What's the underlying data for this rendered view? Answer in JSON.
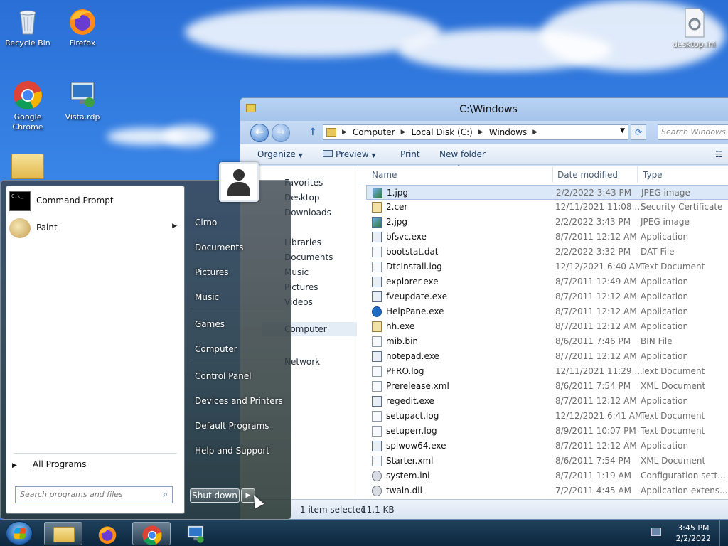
{
  "desktop": {
    "icons": [
      {
        "label": "Recycle Bin",
        "icon": "recycle-bin-icon"
      },
      {
        "label": "Firefox",
        "icon": "firefox-icon"
      },
      {
        "label": "Google Chrome",
        "icon": "chrome-icon"
      },
      {
        "label": "Vista.rdp",
        "icon": "rdp-icon"
      },
      {
        "label": "desktop.ini",
        "icon": "settings-file-icon"
      }
    ]
  },
  "explorer": {
    "title": "C:\\Windows",
    "breadcrumb": [
      "Computer",
      "Local Disk (C:)",
      "Windows"
    ],
    "search_placeholder": "Search Windows",
    "toolbar": {
      "organize": "Organize",
      "preview": "Preview",
      "print": "Print",
      "new_folder": "New folder"
    },
    "nav_items": [
      "Favorites",
      "Desktop",
      "Downloads",
      "Libraries",
      "Documents",
      "Music",
      "Pictures",
      "Videos",
      "Computer",
      "Network"
    ],
    "columns": {
      "name": "Name",
      "date": "Date modified",
      "type": "Type"
    },
    "files": [
      {
        "name": "1.jpg",
        "date": "2/2/2022 3:43 PM",
        "type": "JPEG image",
        "icon": "img",
        "selected": true
      },
      {
        "name": "2.cer",
        "date": "12/11/2021 11:08 ...",
        "type": "Security Certificate",
        "icon": "cer"
      },
      {
        "name": "2.jpg",
        "date": "2/2/2022 3:43 PM",
        "type": "JPEG image",
        "icon": "img"
      },
      {
        "name": "bfsvc.exe",
        "date": "8/7/2011 12:12 AM",
        "type": "Application",
        "icon": "exe"
      },
      {
        "name": "bootstat.dat",
        "date": "2/2/2022 3:32 PM",
        "type": "DAT File",
        "icon": "doc"
      },
      {
        "name": "DtcInstall.log",
        "date": "12/12/2021 6:40 AM",
        "type": "Text Document",
        "icon": "doc"
      },
      {
        "name": "explorer.exe",
        "date": "8/7/2011 12:49 AM",
        "type": "Application",
        "icon": "exe"
      },
      {
        "name": "fveupdate.exe",
        "date": "8/7/2011 12:12 AM",
        "type": "Application",
        "icon": "exe"
      },
      {
        "name": "HelpPane.exe",
        "date": "8/7/2011 12:12 AM",
        "type": "Application",
        "icon": "help"
      },
      {
        "name": "hh.exe",
        "date": "8/7/2011 12:12 AM",
        "type": "Application",
        "icon": "cer"
      },
      {
        "name": "mib.bin",
        "date": "8/6/2011 7:46 PM",
        "type": "BIN File",
        "icon": "doc"
      },
      {
        "name": "notepad.exe",
        "date": "8/7/2011 12:12 AM",
        "type": "Application",
        "icon": "exe"
      },
      {
        "name": "PFRO.log",
        "date": "12/11/2021 11:29 ...",
        "type": "Text Document",
        "icon": "doc"
      },
      {
        "name": "Prerelease.xml",
        "date": "8/6/2011 7:54 PM",
        "type": "XML Document",
        "icon": "doc"
      },
      {
        "name": "regedit.exe",
        "date": "8/7/2011 12:12 AM",
        "type": "Application",
        "icon": "exe"
      },
      {
        "name": "setupact.log",
        "date": "12/12/2021 6:41 AM",
        "type": "Text Document",
        "icon": "doc"
      },
      {
        "name": "setuperr.log",
        "date": "8/9/2011 10:07 PM",
        "type": "Text Document",
        "icon": "doc"
      },
      {
        "name": "splwow64.exe",
        "date": "8/7/2011 12:12 AM",
        "type": "Application",
        "icon": "exe"
      },
      {
        "name": "Starter.xml",
        "date": "8/6/2011 7:54 PM",
        "type": "XML Document",
        "icon": "doc"
      },
      {
        "name": "system.ini",
        "date": "8/7/2011 1:19 AM",
        "type": "Configuration sett...",
        "icon": "gear"
      },
      {
        "name": "twain.dll",
        "date": "7/2/2011 4:45 AM",
        "type": "Application extens...",
        "icon": "gear"
      }
    ],
    "status": {
      "selected": "1 item selected",
      "size": "11.1 KB"
    }
  },
  "start_menu": {
    "pinned": [
      {
        "label": "Command Prompt",
        "icon": "cmd-icon"
      },
      {
        "label": "Paint",
        "icon": "paint-icon",
        "has_submenu": true
      }
    ],
    "all_programs": "All Programs",
    "search_placeholder": "Search programs and files",
    "right_items": [
      "Cirno",
      "Documents",
      "Pictures",
      "Music",
      "Games",
      "Computer",
      "Control Panel",
      "Devices and Printers",
      "Default Programs",
      "Help and Support"
    ],
    "shutdown": "Shut down"
  },
  "taskbar": {
    "time": "3:45 PM",
    "date": "2/2/2022"
  }
}
